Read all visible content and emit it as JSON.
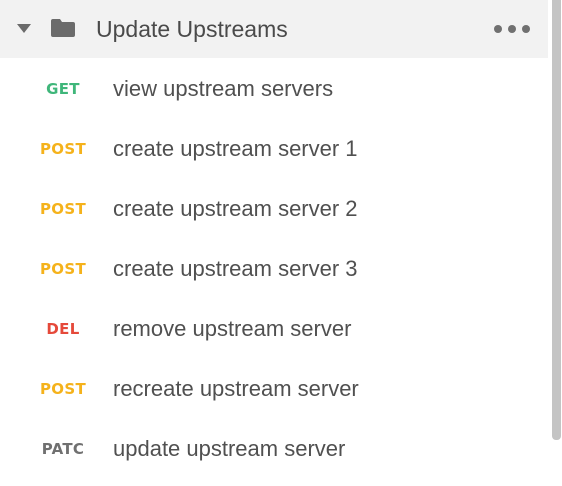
{
  "folder": {
    "title": "Update Upstreams",
    "expanded": true,
    "caret_icon": "caret-down-icon",
    "folder_icon": "folder-icon",
    "more_icon": "more-horizontal-icon"
  },
  "requests": [
    {
      "method": "GET",
      "name": "view upstream servers"
    },
    {
      "method": "POST",
      "name": "create upstream server 1"
    },
    {
      "method": "POST",
      "name": "create upstream server 2"
    },
    {
      "method": "POST",
      "name": "create upstream server 3"
    },
    {
      "method": "DEL",
      "name": "remove upstream server"
    },
    {
      "method": "POST",
      "name": "recreate upstream server"
    },
    {
      "method": "PATC",
      "name": "update upstream server"
    }
  ],
  "method_colors": {
    "GET": "#3fb67a",
    "POST": "#f5b21b",
    "DEL": "#e5493a",
    "PATC": "#707070"
  },
  "colors": {
    "header_bg": "#f2f2f2",
    "text": "#505050",
    "scrollbar_thumb": "#c4c4c4"
  }
}
